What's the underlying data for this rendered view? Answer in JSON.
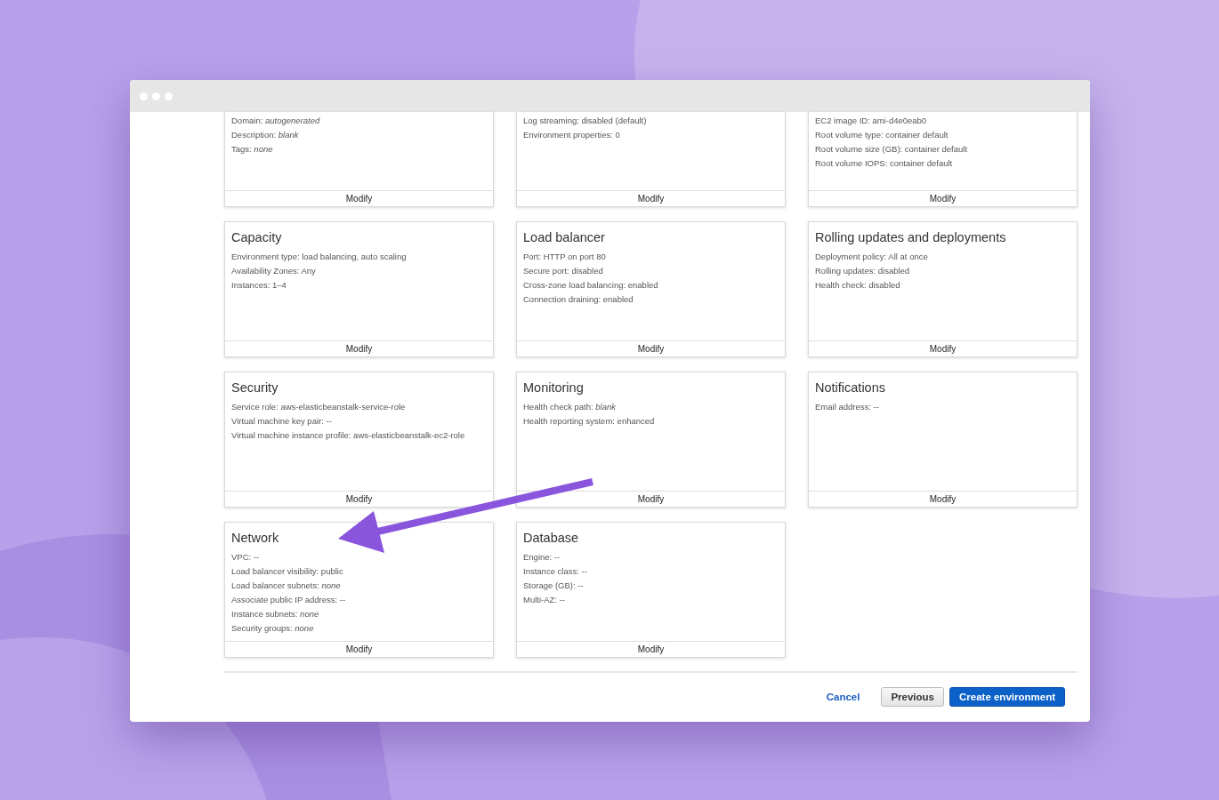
{
  "cards": [
    {
      "cut": true,
      "lines": [
        "Domain: *autogenerated*",
        "Description: *blank*",
        "Tags: *none*"
      ],
      "button": "Modify"
    },
    {
      "cut": true,
      "lines": [
        "Log streaming: disabled (default)",
        "Environment properties: 0"
      ],
      "button": "Modify"
    },
    {
      "cut": true,
      "lines": [
        "EC2 image ID: ami-d4e0eab0",
        "Root volume type: container default",
        "Root volume size (GB): container default",
        "Root volume IOPS: container default"
      ],
      "button": "Modify"
    },
    {
      "cut": false,
      "title": "Capacity",
      "lines": [
        "Environment type: load balancing, auto scaling",
        "Availability Zones: Any",
        "Instances: 1–4"
      ],
      "button": "Modify"
    },
    {
      "cut": false,
      "title": "Load balancer",
      "lines": [
        "Port: HTTP on port 80",
        "Secure port: disabled",
        "Cross-zone load balancing: enabled",
        "Connection draining: enabled"
      ],
      "button": "Modify"
    },
    {
      "cut": false,
      "title": "Rolling updates and deployments",
      "lines": [
        "Deployment policy: All at once",
        "Rolling updates: disabled",
        "Health check: disabled"
      ],
      "button": "Modify"
    },
    {
      "cut": false,
      "title": "Security",
      "lines": [
        "Service role: aws-elasticbeanstalk-service-role",
        "Virtual machine key pair: --",
        "Virtual machine instance profile: aws-elasticbeanstalk-ec2-role"
      ],
      "button": "Modify"
    },
    {
      "cut": false,
      "title": "Monitoring",
      "lines": [
        "Health check path: *blank*",
        "Health reporting system: enhanced"
      ],
      "button": "Modify"
    },
    {
      "cut": false,
      "title": "Notifications",
      "lines": [
        "Email address: --"
      ],
      "button": "Modify"
    },
    {
      "cut": false,
      "title": "Network",
      "lines": [
        "VPC: --",
        "Load balancer visibility: public",
        "Load balancer subnets: *none*",
        "Associate public IP address: --",
        "Instance subnets: *none*",
        "Security groups: *none*"
      ],
      "button": "Modify"
    },
    {
      "cut": false,
      "title": "Database",
      "lines": [
        "Engine: --",
        "Instance class: --",
        "Storage (GB): --",
        "Multi-AZ: --"
      ],
      "button": "Modify"
    }
  ],
  "footer": {
    "buttons": [
      {
        "kind": "link",
        "label": "Cancel"
      },
      {
        "kind": "secondary",
        "label": "Previous"
      },
      {
        "kind": "primary",
        "label": "Create environment"
      }
    ]
  }
}
